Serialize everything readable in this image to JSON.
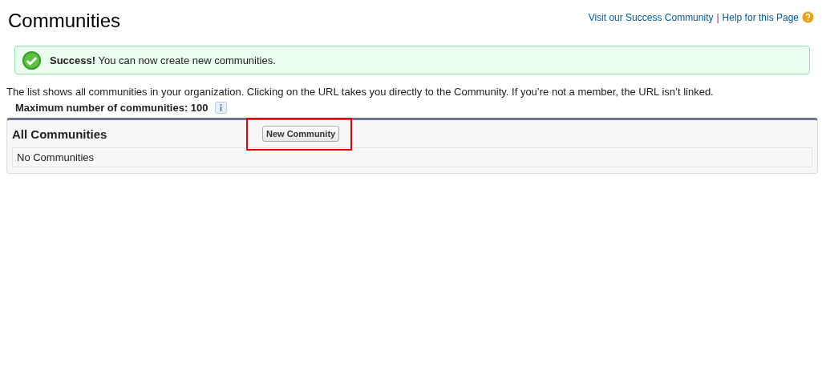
{
  "page_title": "Communities",
  "header_links": [
    "Visit our Success Community",
    "Help for this Page"
  ],
  "link_separator": "|",
  "message": {
    "kind": "success",
    "text": "**Success!** You can now create new communities."
  },
  "description": "The list shows all communities in your organization. Clicking on the URL takes you directly to the Community. If you’re not a member, the URL isn’t linked.",
  "limit": {
    "label": "Maximum number of communities: 100"
  },
  "panel": {
    "title": "All Communities",
    "button": "New Community",
    "button_highlighted": true,
    "empty_text": "No Communities"
  }
}
